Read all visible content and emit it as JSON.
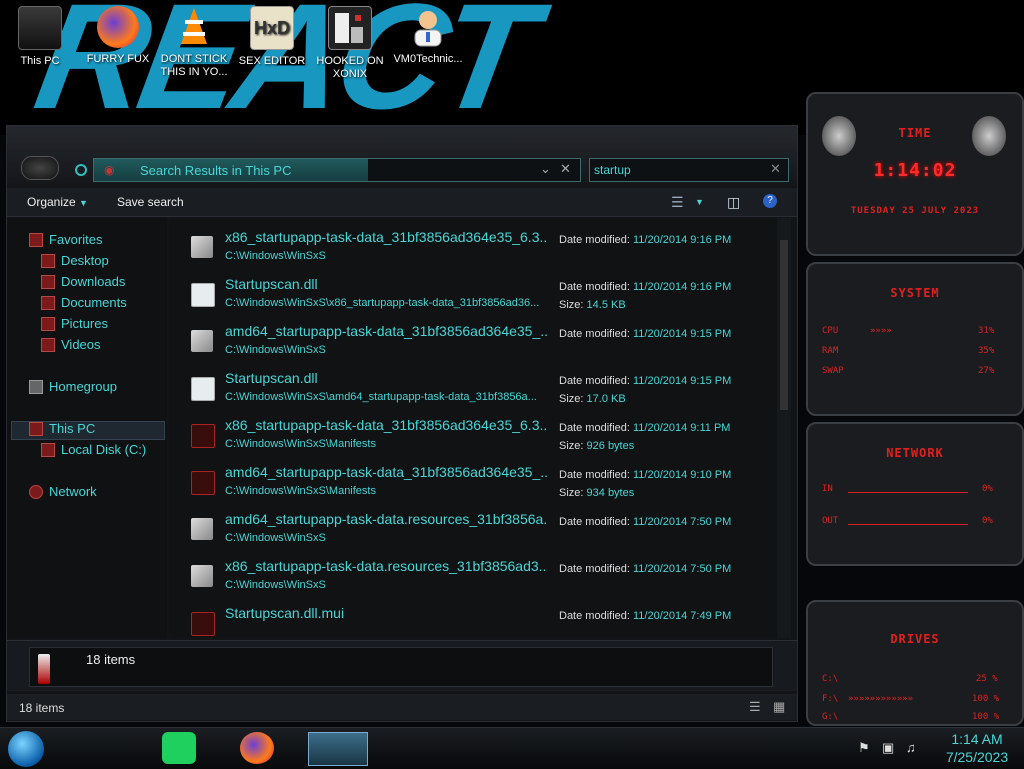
{
  "desktop": {
    "icons": [
      {
        "label": "This PC"
      },
      {
        "label": "FURRY FUX"
      },
      {
        "label": "DONT STICK THIS IN YO..."
      },
      {
        "label": "SEX EDITOR"
      },
      {
        "label": "HOOKED ON XONIX"
      },
      {
        "label": "VM0Technic..."
      }
    ]
  },
  "explorer": {
    "address": "Search Results in This PC",
    "search_query": "startup",
    "toolbar": {
      "organize": "Organize",
      "save_search": "Save search"
    },
    "nav": {
      "favorites": "Favorites",
      "desktop": "Desktop",
      "downloads": "Downloads",
      "documents": "Documents",
      "pictures": "Pictures",
      "videos": "Videos",
      "homegroup": "Homegroup",
      "this_pc": "This PC",
      "local_disk": "Local Disk (C:)",
      "network": "Network"
    },
    "results": [
      {
        "name": "x86_startupapp-task-data_31bf3856ad364e35_6.3....",
        "path": "C:\\Windows\\WinSxS",
        "mod_label": "Date modified:",
        "mod": "11/20/2014 9:16 PM",
        "size_label": "",
        "size": ""
      },
      {
        "name": "Startupscan.dll",
        "path": "C:\\Windows\\WinSxS\\x86_startupapp-task-data_31bf3856ad36...",
        "mod_label": "Date modified:",
        "mod": "11/20/2014 9:16 PM",
        "size_label": "Size:",
        "size": "14.5 KB"
      },
      {
        "name": "amd64_startupapp-task-data_31bf3856ad364e35_...",
        "path": "C:\\Windows\\WinSxS",
        "mod_label": "Date modified:",
        "mod": "11/20/2014 9:15 PM",
        "size_label": "",
        "size": ""
      },
      {
        "name": "Startupscan.dll",
        "path": "C:\\Windows\\WinSxS\\amd64_startupapp-task-data_31bf3856a...",
        "mod_label": "Date modified:",
        "mod": "11/20/2014 9:15 PM",
        "size_label": "Size:",
        "size": "17.0 KB"
      },
      {
        "name": "x86_startupapp-task-data_31bf3856ad364e35_6.3....",
        "path": "C:\\Windows\\WinSxS\\Manifests",
        "mod_label": "Date modified:",
        "mod": "11/20/2014 9:11 PM",
        "size_label": "Size:",
        "size": "926 bytes"
      },
      {
        "name": "amd64_startupapp-task-data_31bf3856ad364e35_...",
        "path": "C:\\Windows\\WinSxS\\Manifests",
        "mod_label": "Date modified:",
        "mod": "11/20/2014 9:10 PM",
        "size_label": "Size:",
        "size": "934 bytes"
      },
      {
        "name": "amd64_startupapp-task-data.resources_31bf3856a...",
        "path": "C:\\Windows\\WinSxS",
        "mod_label": "Date modified:",
        "mod": "11/20/2014 7:50 PM",
        "size_label": "",
        "size": ""
      },
      {
        "name": "x86_startupapp-task-data.resources_31bf3856ad3...",
        "path": "C:\\Windows\\WinSxS",
        "mod_label": "Date modified:",
        "mod": "11/20/2014 7:50 PM",
        "size_label": "",
        "size": ""
      },
      {
        "name": "Startupscan.dll.mui",
        "path": "",
        "mod_label": "Date modified:",
        "mod": "11/20/2014 7:49 PM",
        "size_label": "",
        "size": ""
      }
    ],
    "details_count": "18 items",
    "status_count": "18 items"
  },
  "gadgets": {
    "time": {
      "title": "TIME",
      "clock": "1:14:02",
      "date": "TUESDAY 25 JULY 2023"
    },
    "system": {
      "title": "SYSTEM",
      "cpu_label": "CPU",
      "cpu": "31%",
      "ram_label": "RAM",
      "ram": "35%",
      "swap_label": "SWAP",
      "swap": "27%"
    },
    "network": {
      "title": "NETWORK",
      "in_label": "IN",
      "in": "0%",
      "out_label": "OUT",
      "out": "0%"
    },
    "drives": {
      "title": "DRIVES",
      "c_label": "C:\\",
      "c": "25 %",
      "f_label": "F:\\",
      "f": "100 %",
      "g_label": "G:\\",
      "g": "100 %"
    }
  },
  "taskbar": {
    "time": "1:14 AM",
    "date": "7/25/2023"
  },
  "colors": {
    "accent": "#49d6d6",
    "highlight": "#c8e600",
    "gadget_red": "#e02020"
  }
}
